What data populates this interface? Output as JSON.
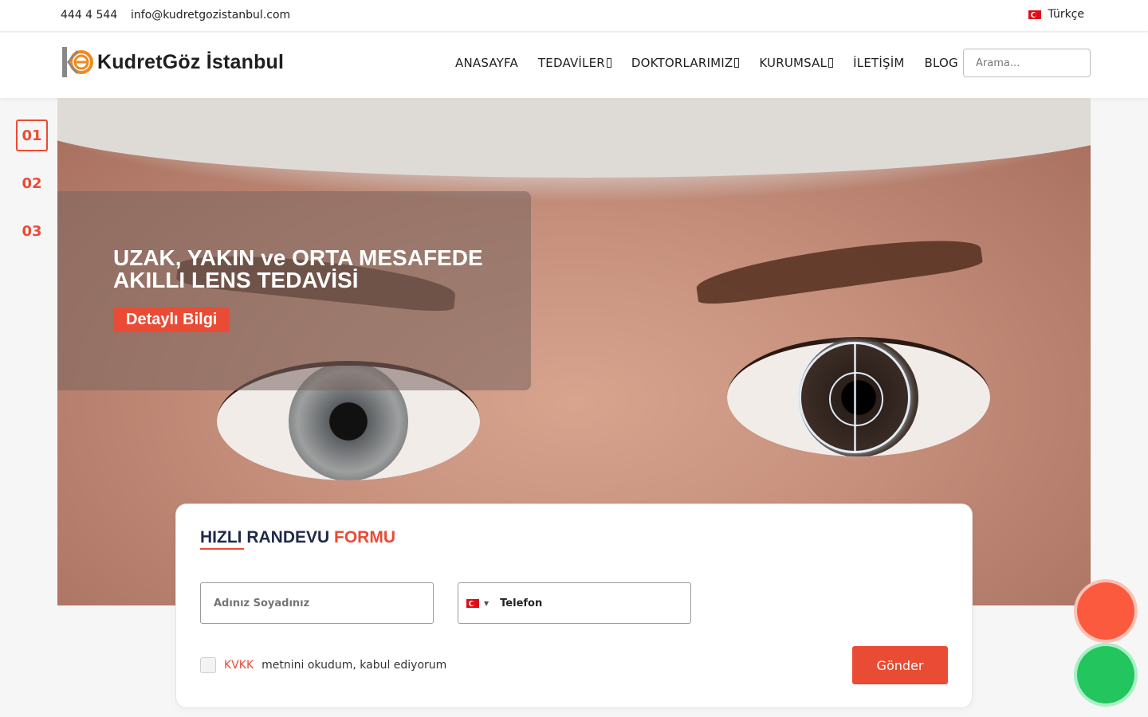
{
  "topbar": {
    "phone": "444 4 544",
    "email": "info@kudretgozistanbul.com",
    "language": "Türkçe"
  },
  "header": {
    "logo_text": "KudretGöz İstanbul",
    "nav": [
      {
        "label": "ANASAYFA",
        "has_dropdown": false
      },
      {
        "label": "TEDAVİLER",
        "has_dropdown": true
      },
      {
        "label": "DOKTORLARIMIZ",
        "has_dropdown": true
      },
      {
        "label": "KURUMSAL",
        "has_dropdown": true
      },
      {
        "label": "İLETİŞİM",
        "has_dropdown": false
      },
      {
        "label": "BLOG",
        "has_dropdown": false
      }
    ],
    "search_placeholder": "Arama..."
  },
  "slider": {
    "numbers": [
      "01",
      "02",
      "03"
    ],
    "active_index": 0,
    "title": "UZAK, YAKIN ve ORTA MESAFEDE AKILLI LENS TEDAVİSİ",
    "button_label": "Detaylı Bilgi"
  },
  "form": {
    "title_main": "HIZLI RANDEVU",
    "title_accent": "FORMU",
    "name_placeholder": "Adınız Soyadınız",
    "phone_placeholder": "Telefon",
    "kvkk_link": "KVKK",
    "kvkk_text": "metnini okudum, kabul ediyorum",
    "submit_label": "Gönder"
  },
  "colors": {
    "accent": "#ea4b34",
    "navy": "#1e2a4a",
    "whatsapp": "#22c55e"
  },
  "icons": [
    "turkey-flag-icon",
    "caret-down-icon",
    "phone-call-icon",
    "whatsapp-icon"
  ]
}
